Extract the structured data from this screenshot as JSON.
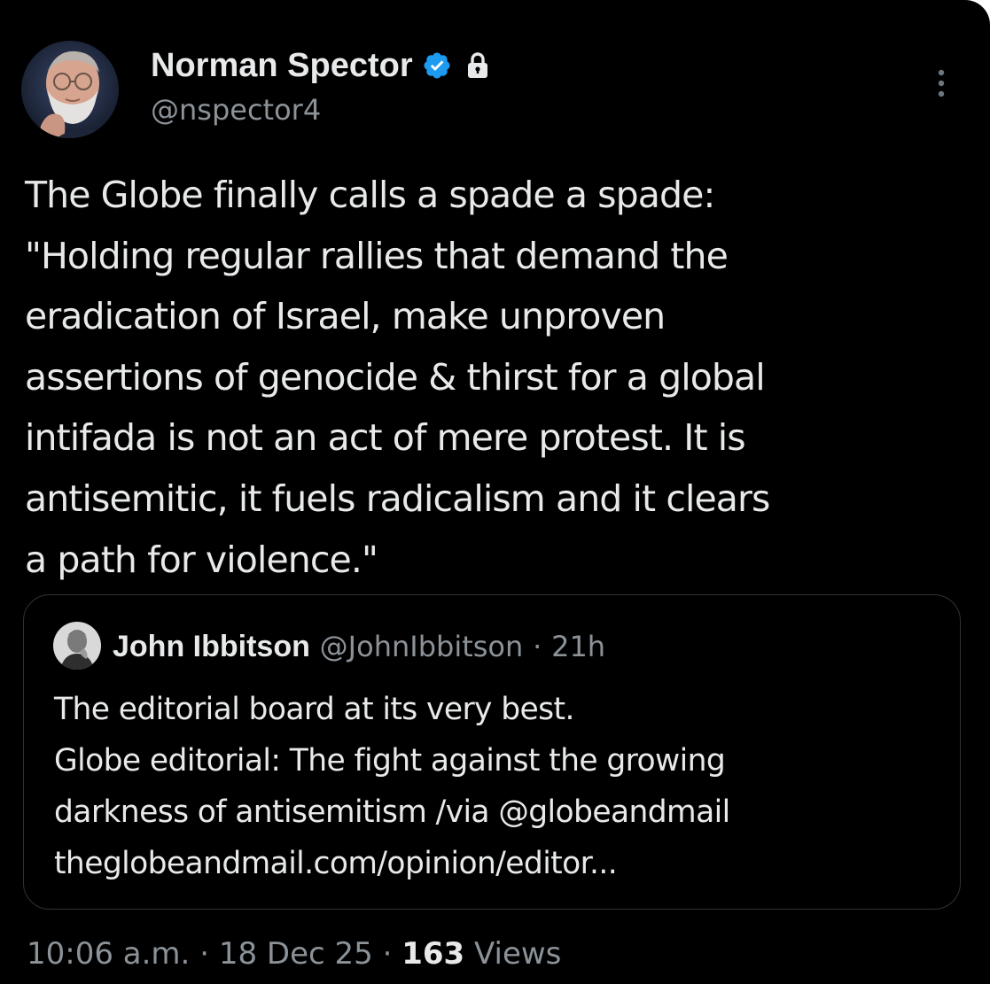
{
  "author": {
    "name": "Norman Spector",
    "handle": "@nspector4",
    "avatar_icon": "bearded-man-avatar",
    "verified_icon": "verified-badge-icon",
    "protected_icon": "lock-icon"
  },
  "more_icon": "vertical-ellipsis-icon",
  "tweet": {
    "text": "The Globe finally calls a spade a spade:\n\"Holding regular rallies that demand the\neradication of Israel, make unproven\nassertions of genocide & thirst for a global\nintifada is not an act of mere protest. It is\nantisemitic, it fuels radicalism and it clears\na path for violence.\""
  },
  "quoted": {
    "name": "John Ibbitson",
    "handle": "@JohnIbbitson",
    "separator": "·",
    "time": "21h",
    "avatar_icon": "grayscale-portrait-avatar",
    "lines": [
      "The editorial board at its very best.",
      "Globe editorial: The fight against the growing",
      "darkness of antisemitism /via @globeandmail",
      "theglobeandmail.com/opinion/editor..."
    ]
  },
  "footer": {
    "time": "10:06 a.m.",
    "date": "18 Dec 25",
    "separator": "·",
    "views_count": "163",
    "views_label": "Views"
  },
  "colors": {
    "background": "#000000",
    "text_primary": "#e7e9ea",
    "text_secondary": "#8b9298",
    "verified_blue": "#1d9bf0",
    "quote_border": "#2f3336"
  }
}
